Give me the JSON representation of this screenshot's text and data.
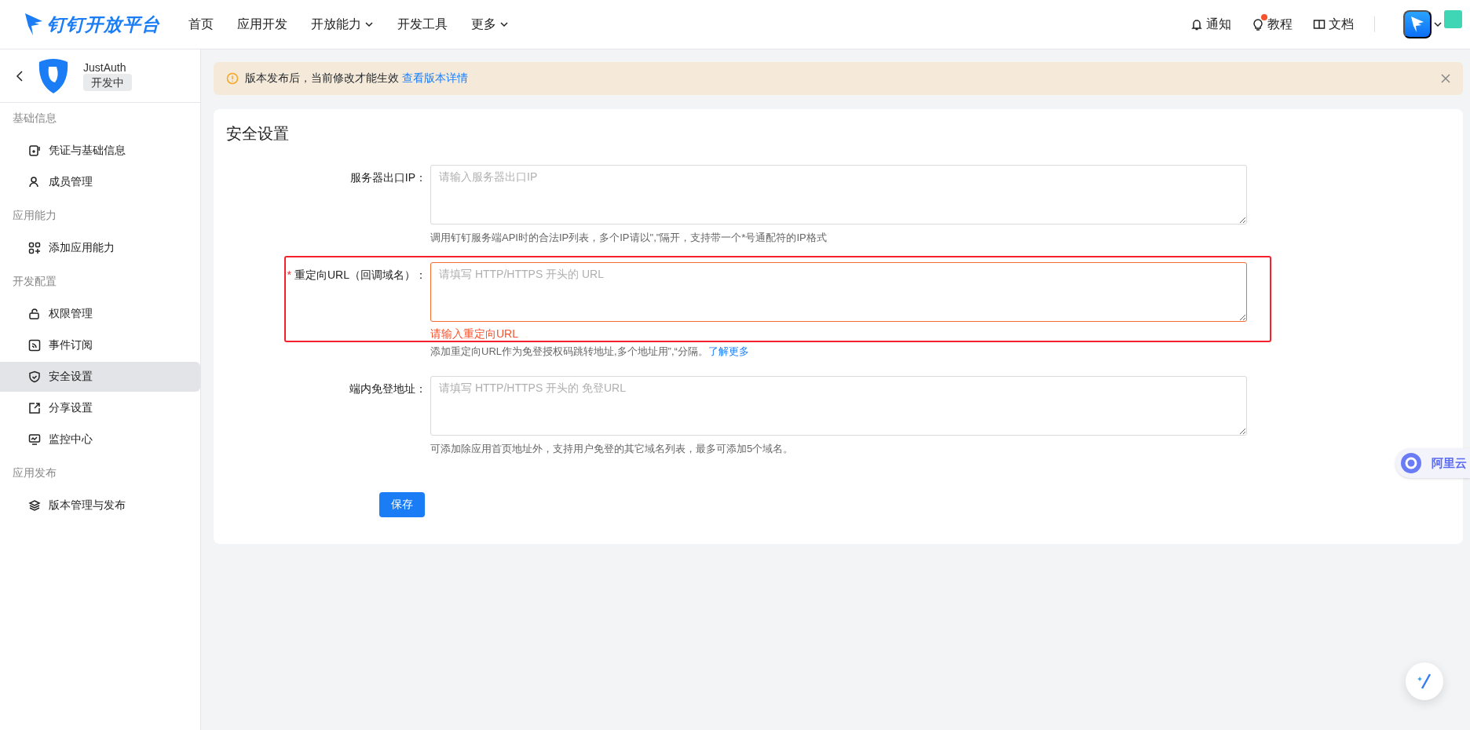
{
  "top_nav": {
    "logo": "钉钉开放平台",
    "items": [
      {
        "label": "首页",
        "has_menu": false
      },
      {
        "label": "应用开发",
        "has_menu": false
      },
      {
        "label": "开放能力",
        "has_menu": true
      },
      {
        "label": "开发工具",
        "has_menu": false
      },
      {
        "label": "更多",
        "has_menu": true
      }
    ]
  },
  "top_actions": [
    {
      "kind": "bell",
      "label": "通知",
      "badge": false
    },
    {
      "kind": "bulb",
      "label": "教程",
      "badge": true
    },
    {
      "kind": "book",
      "label": "文档",
      "badge": false
    }
  ],
  "app": {
    "name": "JustAuth",
    "status": "开发中"
  },
  "sidebar": {
    "groups": [
      {
        "title": "基础信息",
        "items": [
          {
            "label": "凭证与基础信息",
            "selected": false
          },
          {
            "label": "成员管理",
            "selected": false
          }
        ]
      },
      {
        "title": "应用能力",
        "items": [
          {
            "label": "添加应用能力",
            "selected": false
          }
        ]
      },
      {
        "title": "开发配置",
        "items": [
          {
            "label": "权限管理",
            "selected": false
          },
          {
            "label": "事件订阅",
            "selected": false
          },
          {
            "label": "安全设置",
            "selected": true
          },
          {
            "label": "分享设置",
            "selected": false
          },
          {
            "label": "监控中心",
            "selected": false
          }
        ]
      },
      {
        "title": "应用发布",
        "items": [
          {
            "label": "版本管理与发布",
            "selected": false
          }
        ]
      }
    ]
  },
  "notice": {
    "text": "版本发布后，当前修改才能生效",
    "link": "查看版本详情"
  },
  "section": {
    "title": "安全设置",
    "fields": [
      {
        "label": "服务器出口IP：",
        "highlighted": false,
        "placeholder": "请输入服务器出口IP",
        "hint": "调用钉钉服务端API时的合法IP列表，多个IP请以\",\"隔开，支持带一个*号通配符的IP格式"
      },
      {
        "label": "重定向URL（回调域名）：",
        "required_mark": "*",
        "highlighted": true,
        "placeholder": "请填写 HTTP/HTTPS 开头的 URL",
        "error": "请输入重定向URL",
        "hint": "添加重定向URL作为免登授权码跳转地址,多个地址用”,“分隔。",
        "hint_link": "了解更多"
      },
      {
        "label": "端内免登地址：",
        "highlighted": false,
        "placeholder": "请填写 HTTP/HTTPS 开头的 免登URL",
        "hint": "可添加除应用首页地址外，支持用户免登的其它域名列表，最多可添加5个域名。"
      }
    ],
    "save_button": "保存"
  },
  "side_widget": {
    "label": "阿里云"
  }
}
